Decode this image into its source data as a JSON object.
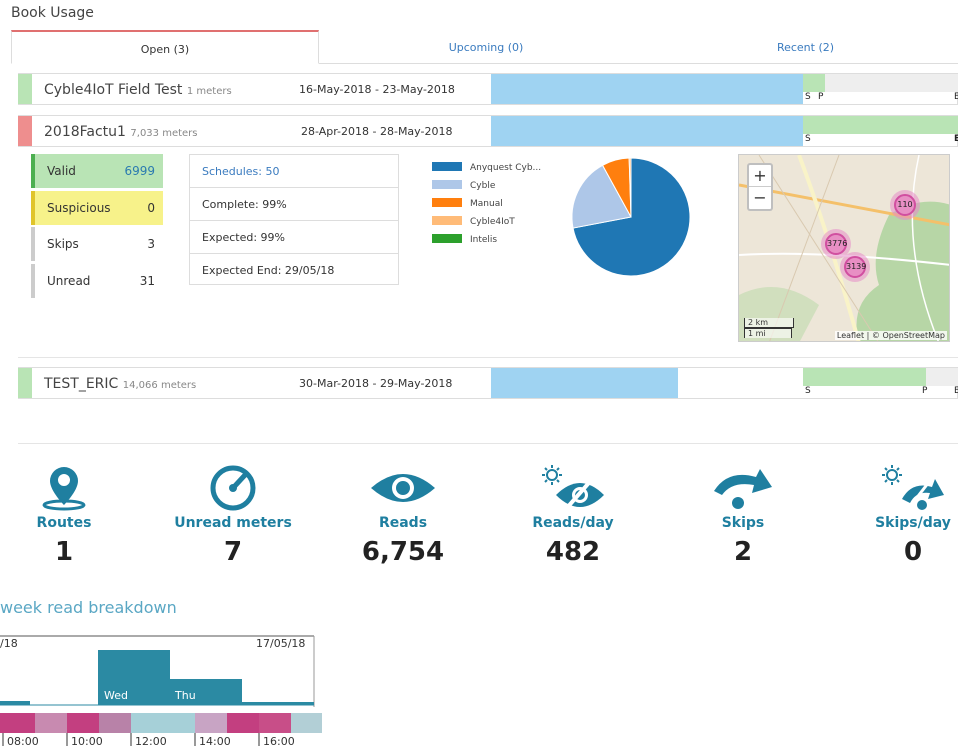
{
  "page_title": "Book Usage",
  "tabs": [
    {
      "label": "Open (3)"
    },
    {
      "label": "Upcoming (0)"
    },
    {
      "label": "Recent (2)"
    }
  ],
  "books": [
    {
      "name": "Cyble4IoT Field Test",
      "meters": "1 meters",
      "dates": "16-May-2018 - 23-May-2018",
      "stripe": "#b9e4b5",
      "labels": [
        "S",
        "P",
        "E"
      ]
    },
    {
      "name": "2018Factu1",
      "meters": "7,033 meters",
      "dates": "28-Apr-2018 - 28-May-2018",
      "stripe": "#ee8e8e",
      "labels": [
        "S",
        "E"
      ]
    },
    {
      "name": "TEST_ERIC",
      "meters": "14,066 meters",
      "dates": "30-Mar-2018 - 29-May-2018",
      "stripe": "#b9e4b5",
      "labels": [
        "S",
        "P",
        "E"
      ]
    }
  ],
  "status": [
    {
      "label": "Valid",
      "value": "6999",
      "bg": "#b9e4b5",
      "border": "#4caf50",
      "valcolor": "#2a7ab0"
    },
    {
      "label": "Suspicious",
      "value": "0",
      "bg": "#f7f28a",
      "border": "#e0c42a",
      "valcolor": "#222"
    },
    {
      "label": "Skips",
      "value": "3",
      "bg": "#fff",
      "border": "#ccc",
      "valcolor": "#222"
    },
    {
      "label": "Unread",
      "value": "31",
      "bg": "#fff",
      "border": "#ccc",
      "valcolor": "#222"
    }
  ],
  "schedules": {
    "schedules": "Schedules: 50",
    "complete": "Complete: 99%",
    "expected": "Expected: 99%",
    "expected_end": "Expected End: 29/05/18"
  },
  "pie": {
    "legend": [
      {
        "label": "Anyquest Cyb...",
        "color": "#1f77b4"
      },
      {
        "label": "Cyble",
        "color": "#aec7e8"
      },
      {
        "label": "Manual",
        "color": "#ff7f0e"
      },
      {
        "label": "Cyble4IoT",
        "color": "#ffbb78"
      },
      {
        "label": "Intelis",
        "color": "#2ca02c"
      }
    ],
    "slices": [
      {
        "label": "Anyquest Cyb...",
        "value": 72
      },
      {
        "label": "Cyble",
        "value": 20
      },
      {
        "label": "Manual",
        "value": 7.5
      },
      {
        "label": "Cyble4IoT",
        "value": 0.5
      },
      {
        "label": "Intelis",
        "value": 0
      }
    ]
  },
  "map": {
    "zoom_in": "+",
    "zoom_out": "−",
    "clusters": [
      "110",
      "3776",
      "3139"
    ],
    "scale_km": "2 km",
    "scale_mi": "1 mi",
    "attribution": "Leaflet | © OpenStreetMap"
  },
  "stats": [
    {
      "label": "Routes",
      "value": "1",
      "icon": "map-pin-icon"
    },
    {
      "label": "Unread meters",
      "value": "7",
      "icon": "gauge-icon"
    },
    {
      "label": "Reads",
      "value": "6,754",
      "icon": "eye-icon"
    },
    {
      "label": "Reads/day",
      "value": "482",
      "icon": "eye-sun-icon"
    },
    {
      "label": "Skips",
      "value": "2",
      "icon": "skip-arrow-icon"
    },
    {
      "label": "Skips/day",
      "value": "0",
      "icon": "skip-sun-icon"
    }
  ],
  "week": {
    "title": "week read breakdown",
    "start_label": "/18",
    "end_label": "17/05/18",
    "days": [
      "Wed",
      "Thu"
    ],
    "hours": [
      "08:00",
      "10:00",
      "12:00",
      "14:00",
      "16:00"
    ]
  }
}
